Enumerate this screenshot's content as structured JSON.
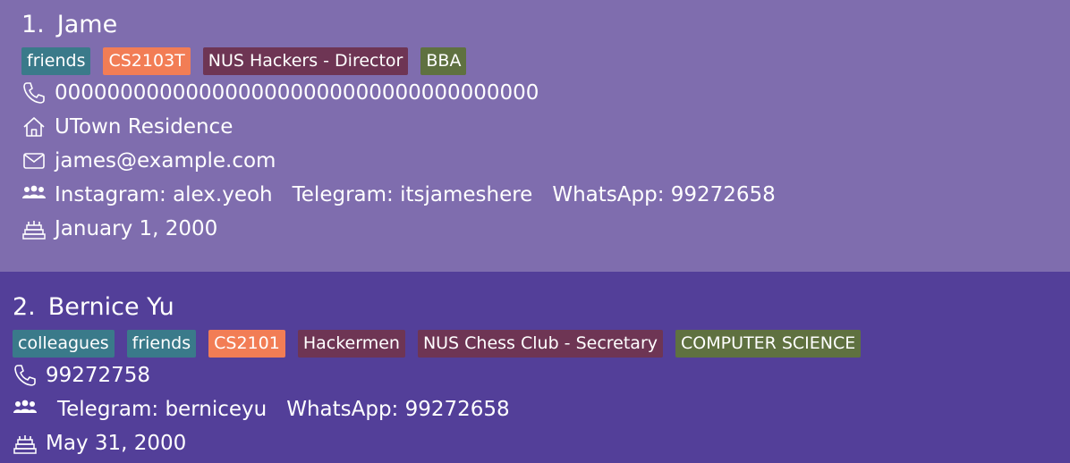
{
  "colors": {
    "card1_bg": "#7f6dae",
    "card2_bg": "#533f99",
    "tag_teal": "#3a7a8a",
    "tag_orange": "#f27d55",
    "tag_maroon": "#6e3554",
    "tag_green": "#5f7140"
  },
  "persons": [
    {
      "index": "1.",
      "name": "Jame",
      "tags": [
        {
          "label": "friends",
          "color": "teal"
        },
        {
          "label": "CS2103T",
          "color": "orange"
        },
        {
          "label": "NUS Hackers - Director",
          "color": "maroon"
        },
        {
          "label": "BBA",
          "color": "green"
        }
      ],
      "phone": "0000000000000000000000000000000000000",
      "address": "UTown Residence",
      "email": "james@example.com",
      "socials": [
        "Instagram: alex.yeoh",
        "Telegram: itsjameshere",
        "WhatsApp: 99272658"
      ],
      "birthday": "January 1, 2000",
      "icons": [
        "phone-icon",
        "home-icon",
        "mail-icon",
        "people-icon",
        "cake-icon"
      ]
    },
    {
      "index": "2.",
      "name": "Bernice Yu",
      "tags": [
        {
          "label": "colleagues",
          "color": "teal"
        },
        {
          "label": "friends",
          "color": "teal"
        },
        {
          "label": "CS2101",
          "color": "orange"
        },
        {
          "label": "Hackermen",
          "color": "maroon"
        },
        {
          "label": "NUS Chess Club - Secretary",
          "color": "maroon"
        },
        {
          "label": "COMPUTER SCIENCE",
          "color": "green"
        }
      ],
      "phone": "99272758",
      "socials": [
        "Telegram: berniceyu",
        "WhatsApp: 99272658"
      ],
      "birthday": "May 31, 2000",
      "icons": [
        "phone-icon",
        "people-icon",
        "cake-icon"
      ]
    }
  ]
}
